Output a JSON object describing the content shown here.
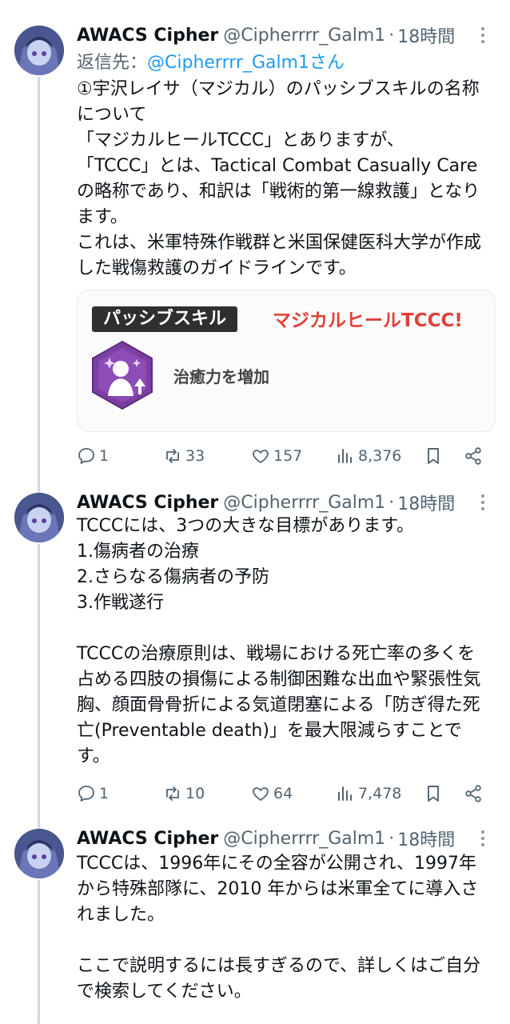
{
  "tweets": [
    {
      "author": {
        "name": "AWACS Cipher",
        "handle": "@Cipherrrr_Galm1",
        "time": "18時間"
      },
      "reply_to": {
        "prefix": "返信先：",
        "handle": "@Cipherrrr_Galm1さん"
      },
      "text": "①宇沢レイサ（マジカル）のパッシブスキルの名称について\n「マジカルヒールTCCC」とありますが、\n「TCCC」とは、Tactical Combat Casually Careの略称であり、和訳は「戦術的第一線救護」となります。\nこれは、米軍特殊作戦群と米国保健医科大学が作成した戦傷救護のガイドラインです。",
      "card": {
        "tag": "パッシブスキル",
        "title": "マジカルヒールTCCC!",
        "description": "治癒力を増加"
      },
      "stats": {
        "replies": "1",
        "retweets": "33",
        "likes": "157",
        "views": "8,376"
      }
    },
    {
      "author": {
        "name": "AWACS Cipher",
        "handle": "@Cipherrrr_Galm1",
        "time": "18時間"
      },
      "text": "TCCCには、3つの大きな目標があります。\n1.傷病者の治療\n2.さらなる傷病者の予防\n3.作戦遂行\n\nTCCCの治療原則は、戦場における死亡率の多くを占める四肢の損傷による制御困難な出血や緊張性気胸、顔面骨骨折による気道閉塞による「防ぎ得た死亡(Preventable death)」を最大限減らすことです。",
      "stats": {
        "replies": "1",
        "retweets": "10",
        "likes": "64",
        "views": "7,478"
      }
    },
    {
      "author": {
        "name": "AWACS Cipher",
        "handle": "@Cipherrrr_Galm1",
        "time": "18時間"
      },
      "text": "TCCCは、1996年にその全容が公開され、1997年から特殊部隊に、2010 年からは米軍全てに導入されました。\n\nここで説明するには長すぎるので、詳しくはご自分で検索してください。"
    }
  ],
  "icons": [
    "more-icon",
    "reply-icon",
    "retweet-icon",
    "like-icon",
    "views-icon",
    "bookmark-icon",
    "share-icon"
  ],
  "colors": {
    "link": "#1d9bf0",
    "secondary": "#536471",
    "accent_red": "#e1403a",
    "skill_purple": "#7b3fa0"
  }
}
